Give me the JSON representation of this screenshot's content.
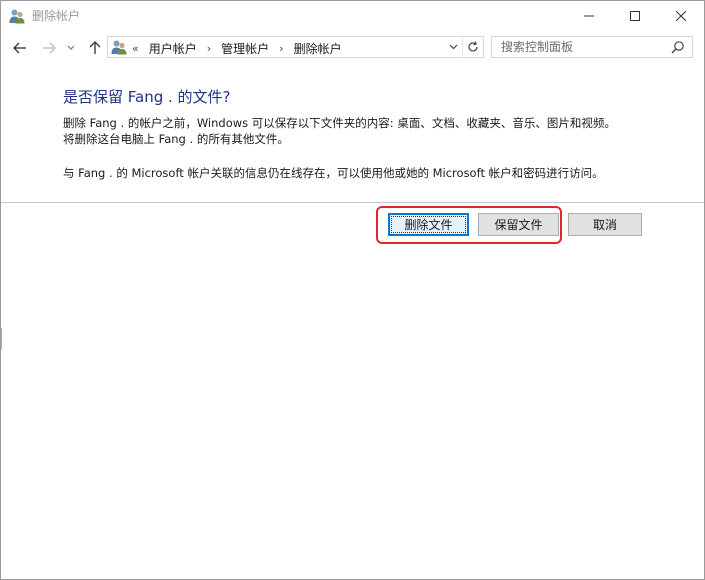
{
  "window": {
    "title": "删除帐户",
    "icon": "user-accounts-icon"
  },
  "nav": {
    "back_icon": "arrow-left-icon",
    "forward_icon": "arrow-right-icon",
    "recent_icon": "chevron-down-icon",
    "up_icon": "arrow-up-icon"
  },
  "address": {
    "lead": "«",
    "crumbs": [
      "用户帐户",
      "管理帐户",
      "删除帐户"
    ],
    "separator": "›"
  },
  "search": {
    "placeholder": "搜索控制面板"
  },
  "content": {
    "heading": "是否保留 Fang . 的文件?",
    "line1": "删除 Fang . 的帐户之前，Windows 可以保存以下文件夹的内容: 桌面、文档、收藏夹、音乐、图片和视频。",
    "line2": "将删除这台电脑上 Fang . 的所有其他文件。",
    "line3": "与 Fang . 的 Microsoft 帐户关联的信息仍在线存在，可以使用他或她的 Microsoft 帐户和密码进行访问。"
  },
  "buttons": {
    "delete_files": "删除文件",
    "keep_files": "保留文件",
    "cancel": "取消"
  },
  "colors": {
    "heading": "#1e3287",
    "highlight": "#e0262e",
    "focus": "#0078d7"
  }
}
